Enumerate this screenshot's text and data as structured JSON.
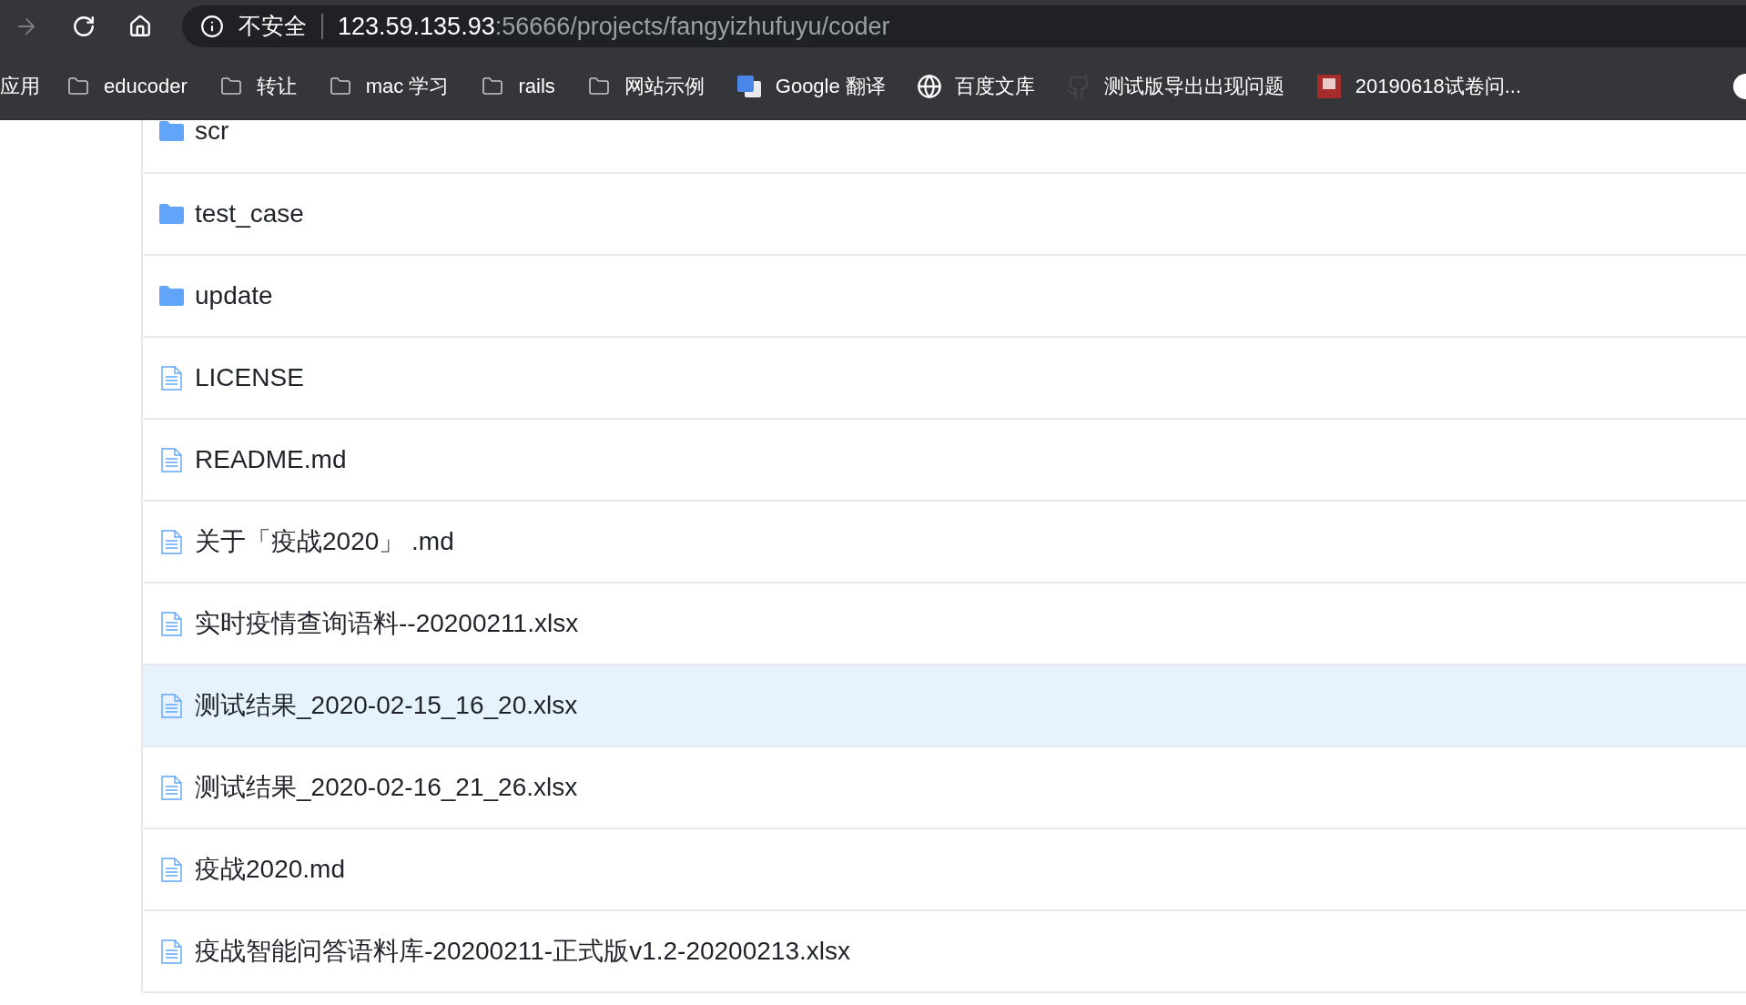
{
  "toolbar": {
    "back": {
      "disabled": true
    },
    "security_label": "不安全",
    "url_host": "123.59.135.93",
    "url_path": ":56666/projects/fangyizhufuyu/coder"
  },
  "bookmarks": [
    {
      "kind": "text",
      "label": "应用"
    },
    {
      "kind": "folder",
      "label": "educoder"
    },
    {
      "kind": "folder",
      "label": "转让"
    },
    {
      "kind": "folder",
      "label": "mac 学习"
    },
    {
      "kind": "folder",
      "label": "rails"
    },
    {
      "kind": "folder",
      "label": "网站示例"
    },
    {
      "kind": "translate",
      "label": "Google 翻译"
    },
    {
      "kind": "globe",
      "label": "百度文库"
    },
    {
      "kind": "github",
      "label": "测试版导出出现问题"
    },
    {
      "kind": "image",
      "label": "20190618试卷问..."
    },
    {
      "kind": "partial"
    }
  ],
  "files": [
    {
      "kind": "folder",
      "name": "scr",
      "selected": false
    },
    {
      "kind": "folder",
      "name": "test_case",
      "selected": false
    },
    {
      "kind": "folder",
      "name": "update",
      "selected": false
    },
    {
      "kind": "file",
      "name": "LICENSE",
      "selected": false
    },
    {
      "kind": "file",
      "name": "README.md",
      "selected": false
    },
    {
      "kind": "file",
      "name": "关于「疫战2020」 .md",
      "selected": false
    },
    {
      "kind": "file",
      "name": "实时疫情查询语料--20200211.xlsx",
      "selected": false
    },
    {
      "kind": "file",
      "name": "测试结果_2020-02-15_16_20.xlsx",
      "selected": true
    },
    {
      "kind": "file",
      "name": "测试结果_2020-02-16_21_26.xlsx",
      "selected": false
    },
    {
      "kind": "file",
      "name": "疫战2020.md",
      "selected": false
    },
    {
      "kind": "file",
      "name": "疫战智能问答语料库-20200211-正式版v1.2-20200213.xlsx",
      "selected": false
    }
  ]
}
